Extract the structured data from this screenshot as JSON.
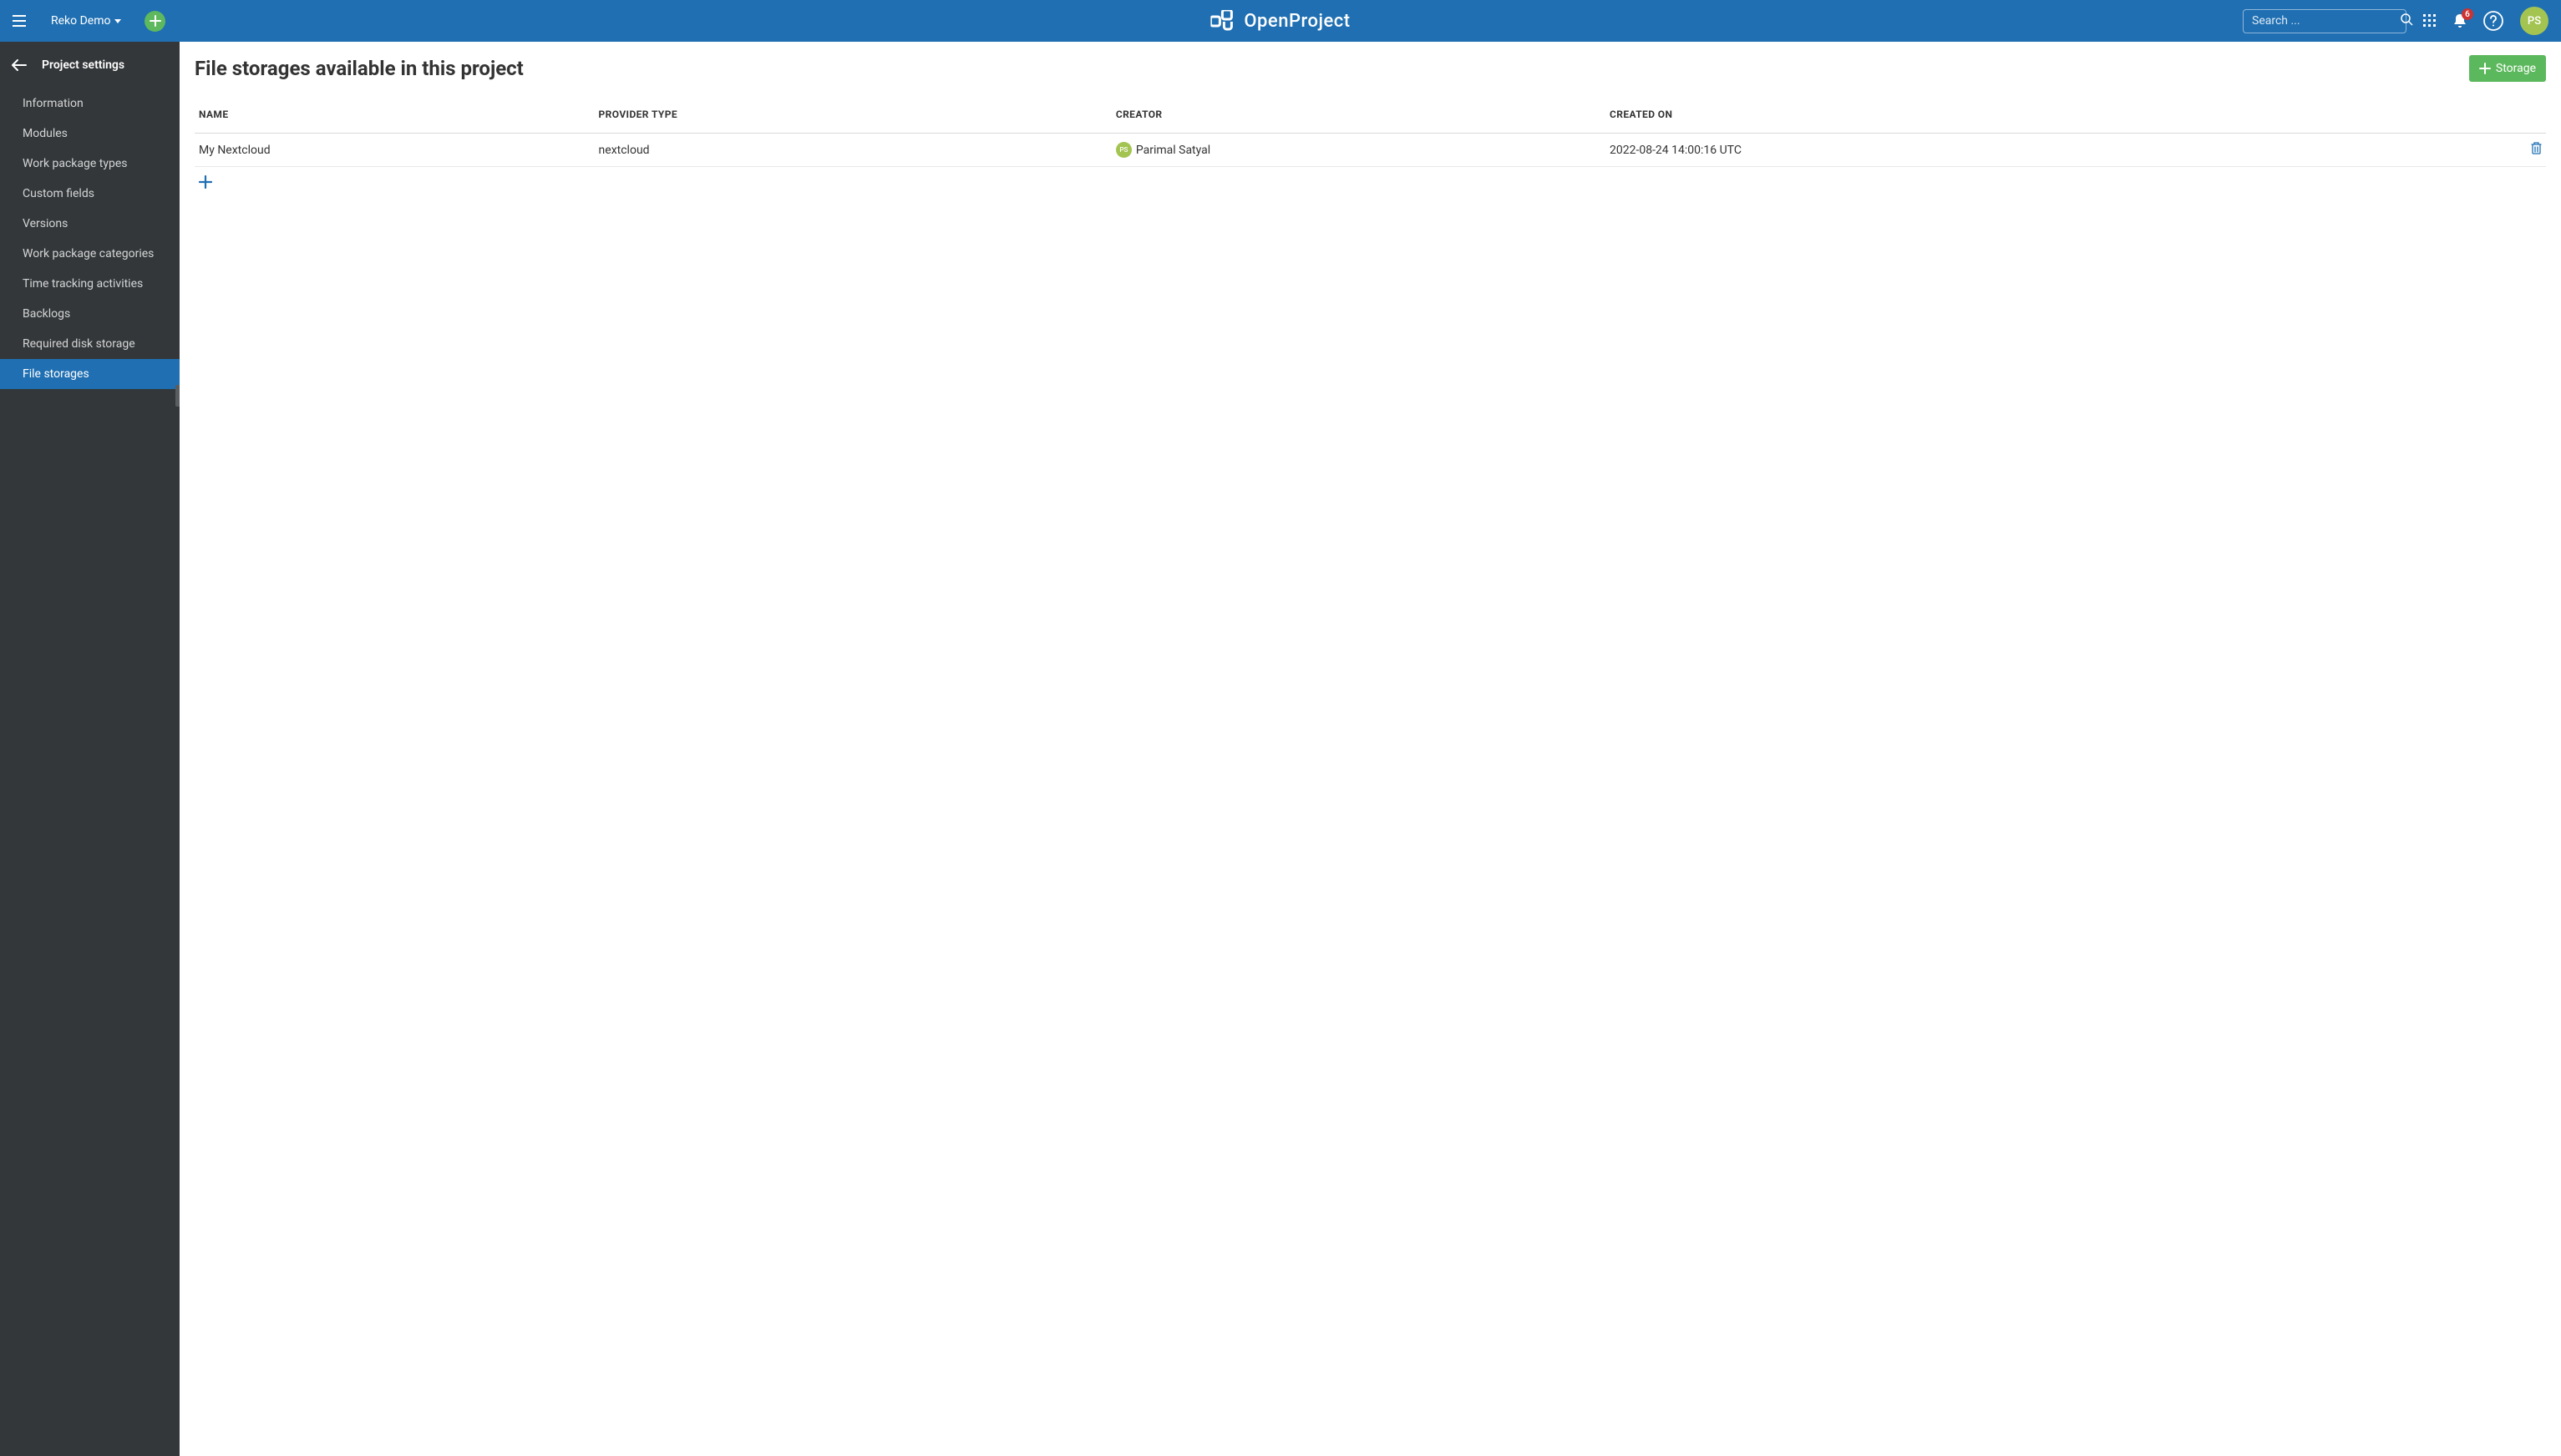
{
  "header": {
    "project_name": "Reko Demo",
    "logo_text": "OpenProject",
    "search_placeholder": "Search ...",
    "notification_count": "6",
    "user_initials": "PS"
  },
  "sidebar": {
    "title": "Project settings",
    "items": [
      {
        "label": "Information",
        "active": false
      },
      {
        "label": "Modules",
        "active": false
      },
      {
        "label": "Work package types",
        "active": false
      },
      {
        "label": "Custom fields",
        "active": false
      },
      {
        "label": "Versions",
        "active": false
      },
      {
        "label": "Work package categories",
        "active": false
      },
      {
        "label": "Time tracking activities",
        "active": false
      },
      {
        "label": "Backlogs",
        "active": false
      },
      {
        "label": "Required disk storage",
        "active": false
      },
      {
        "label": "File storages",
        "active": true
      }
    ]
  },
  "main": {
    "title": "File storages available in this project",
    "storage_button_label": "Storage",
    "table": {
      "headers": {
        "name": "NAME",
        "provider": "PROVIDER TYPE",
        "creator": "CREATOR",
        "created_on": "CREATED ON"
      },
      "rows": [
        {
          "name": "My Nextcloud",
          "provider": "nextcloud",
          "creator_initials": "PS",
          "creator_name": "Parimal Satyal",
          "created_on": "2022-08-24 14:00:16 UTC"
        }
      ]
    }
  }
}
